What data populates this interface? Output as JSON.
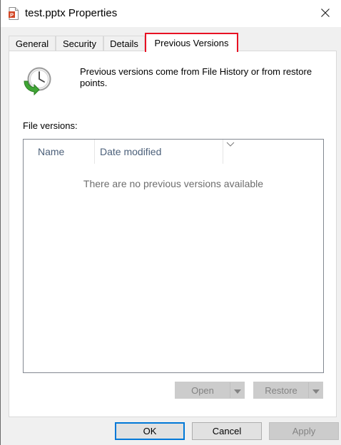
{
  "window": {
    "title": "test.pptx Properties",
    "app_icon": "powerpoint-file-icon",
    "close_icon": "close-icon"
  },
  "tabs": [
    {
      "label": "General",
      "active": false
    },
    {
      "label": "Security",
      "active": false
    },
    {
      "label": "Details",
      "active": false
    },
    {
      "label": "Previous Versions",
      "active": true
    }
  ],
  "previous_versions": {
    "icon": "file-history-clock-icon",
    "intro": "Previous versions come from File History or from restore points.",
    "list_label": "File versions:",
    "columns": [
      "Name",
      "Date modified"
    ],
    "sorted_column": "Date modified",
    "empty_message": "There are no previous versions available",
    "open_button": {
      "label": "Open",
      "enabled": false
    },
    "restore_button": {
      "label": "Restore",
      "enabled": false
    }
  },
  "footer": {
    "ok_label": "OK",
    "cancel_label": "Cancel",
    "apply_label": "Apply",
    "apply_enabled": false
  },
  "colors": {
    "highlight": "#e81123",
    "default_button_border": "#0078d7",
    "powerpoint": "#d24726",
    "history_green": "#3fa535"
  }
}
